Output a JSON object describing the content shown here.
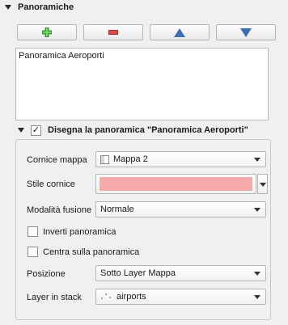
{
  "section": {
    "title": "Panoramiche"
  },
  "toolbar": {
    "add_icon": "plus-icon",
    "remove_icon": "minus-icon",
    "up_icon": "triangle-up-icon",
    "down_icon": "triangle-down-icon",
    "colors": {
      "add": "#3aa535",
      "remove": "#e04848",
      "move": "#3d6eb4"
    }
  },
  "overviews": {
    "items": [
      "Panoramica Aeroporti"
    ]
  },
  "group": {
    "checked": "✓",
    "title": "Disegna la panoramica \"Panoramica Aeroporti\""
  },
  "fields": {
    "frame_map_label": "Cornice mappa",
    "frame_map_value": "Mappa 2",
    "frame_style_label": "Stile cornice",
    "frame_style_color": "#f5aaaa",
    "blend_mode_label": "Modalità fusione",
    "blend_mode_value": "Normale",
    "invert_label": "Inverti panoramica",
    "center_label": "Centra sulla panoramica",
    "position_label": "Posizione",
    "position_value": "Sotto Layer Mappa",
    "stack_layer_label": "Layer in stack",
    "stack_layer_value": "airports"
  }
}
